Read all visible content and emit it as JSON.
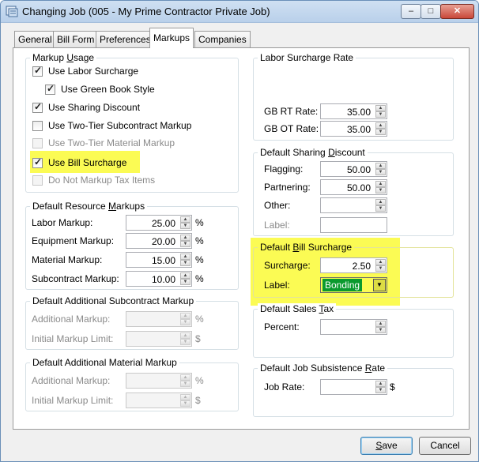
{
  "window": {
    "title": "Changing Job  (005 - My Prime Contractor Private Job)",
    "min_glyph": "–",
    "max_glyph": "□",
    "close_glyph": "✕"
  },
  "tabs": [
    "General",
    "Bill Form",
    "Preferences",
    "Markups",
    "Companies"
  ],
  "active_tab": "Markups",
  "markup_usage": {
    "title": "Markup Usage",
    "title_parts": [
      "Markup ",
      "U",
      "sage"
    ],
    "items": [
      {
        "label": "Use Labor Surcharge",
        "checked": true,
        "enabled": true
      },
      {
        "label": "Use Green Book Style",
        "checked": true,
        "enabled": true
      },
      {
        "label": "Use Sharing Discount",
        "checked": true,
        "enabled": true
      },
      {
        "label": "Use Two-Tier Subcontract Markup",
        "checked": false,
        "enabled": true
      },
      {
        "label": "Use Two-Tier Material Markup",
        "checked": false,
        "enabled": false
      },
      {
        "label": "Use Bill Surcharge",
        "checked": true,
        "enabled": true,
        "highlighted": true
      },
      {
        "label": "Do Not Markup Tax Items",
        "checked": false,
        "enabled": false
      }
    ]
  },
  "resource_markups": {
    "title_parts": [
      "Default Resource ",
      "M",
      "arkups"
    ],
    "rows": [
      {
        "label": "Labor Markup:",
        "value": "25.00",
        "unit": "%"
      },
      {
        "label": "Equipment Markup:",
        "value": "20.00",
        "unit": "%"
      },
      {
        "label": "Material Markup:",
        "value": "15.00",
        "unit": "%"
      },
      {
        "label": "Subcontract Markup:",
        "value": "10.00",
        "unit": "%"
      }
    ]
  },
  "add_subcontract": {
    "title": "Default Additional Subcontract Markup",
    "rows": [
      {
        "label": "Additional Markup:",
        "value": "",
        "unit": "%"
      },
      {
        "label": "Initial Markup Limit:",
        "value": "",
        "unit": "$"
      }
    ]
  },
  "add_material": {
    "title": "Default Additional Material Markup",
    "rows": [
      {
        "label": "Additional Markup:",
        "value": "",
        "unit": "%"
      },
      {
        "label": "Initial Markup Limit:",
        "value": "",
        "unit": "$"
      }
    ]
  },
  "labor_surcharge": {
    "title": "Labor Surcharge Rate",
    "rows": [
      {
        "label": "GB RT Rate:",
        "value": "35.00"
      },
      {
        "label": "GB OT Rate:",
        "value": "35.00"
      }
    ]
  },
  "sharing_discount": {
    "title_parts": [
      "Default Sharing ",
      "D",
      "iscount"
    ],
    "rows": [
      {
        "label": "Flagging:",
        "value": "50.00"
      },
      {
        "label": "Partnering:",
        "value": "50.00"
      },
      {
        "label": "Other:",
        "value": ""
      }
    ],
    "label_field": {
      "label": "Label:",
      "value": ""
    }
  },
  "bill_surcharge": {
    "title_parts": [
      "Default ",
      "B",
      "ill Surcharge"
    ],
    "surcharge_label": "Surcharge:",
    "surcharge_value": "2.50",
    "label_label": "Label:",
    "label_value": "Bonding",
    "dropdown_glyph": "▼"
  },
  "sales_tax": {
    "title_parts": [
      "Default Sales ",
      "T",
      "ax"
    ],
    "percent_label": "Percent:",
    "percent_value": ""
  },
  "subsistence": {
    "title_parts": [
      "Default Job Subsistence ",
      "R",
      "ate"
    ],
    "job_rate_label": "Job Rate:",
    "job_rate_value": "",
    "unit": "$"
  },
  "buttons": {
    "save_parts": [
      "S",
      "ave"
    ],
    "cancel": "Cancel"
  },
  "spin": {
    "up": "▲",
    "down": "▼"
  },
  "colors": {
    "highlight": "#fbfb54",
    "selection": "#0a9a2e"
  }
}
